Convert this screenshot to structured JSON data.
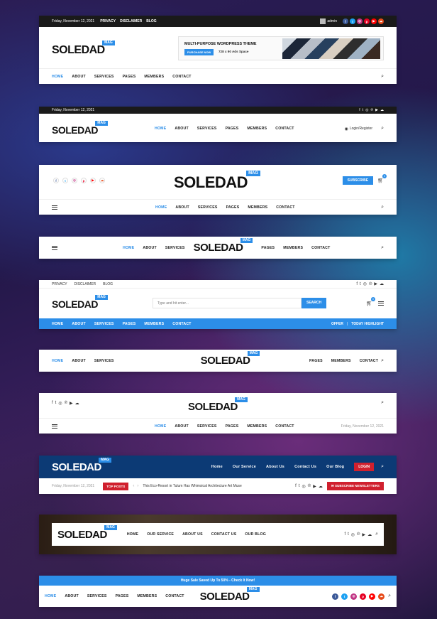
{
  "date": "Friday, November 12, 2021",
  "logo": {
    "text": "SOLEDAD",
    "badge": "MAG"
  },
  "h1": {
    "top_links": [
      "PRIVACY",
      "DISCLAIMER",
      "BLOG"
    ],
    "admin": "admin",
    "ad_title": "MULTI-PURPOSE WORDPRESS THEME",
    "ad_button": "PURCHASE NOW",
    "ad_size": "728 x 90 Ads Space",
    "nav": [
      "HOME",
      "ABOUT",
      "SERVICES",
      "PAGES",
      "MEMBERS",
      "CONTACT"
    ]
  },
  "h2": {
    "nav": [
      "HOME",
      "ABOUT",
      "SERVICES",
      "PAGES",
      "MEMBERS",
      "CONTACT"
    ],
    "login": "Login/Register"
  },
  "h3": {
    "subscribe": "SUBSCRIBE",
    "cart_count": "0",
    "nav": [
      "HOME",
      "ABOUT",
      "SERVICES",
      "PAGES",
      "MEMBERS",
      "CONTACT"
    ]
  },
  "h4": {
    "nav_left": [
      "HOME",
      "ABOUT",
      "SERVICES"
    ],
    "nav_right": [
      "PAGES",
      "MEMBERS",
      "CONTACT"
    ]
  },
  "h5": {
    "top_links": [
      "PRIVACY",
      "DISCLAIMER",
      "BLOG"
    ],
    "search_placeholder": "Type and hit enter...",
    "search_button": "SEARCH",
    "cart_count": "0",
    "nav": [
      "HOME",
      "ABOUT",
      "SERVICES",
      "PAGES",
      "MEMBERS",
      "CONTACT"
    ],
    "right_links": [
      "OFFER",
      "TODAY HIGHLIGHT"
    ]
  },
  "h6": {
    "nav_left": [
      "HOME",
      "ABOUT",
      "SERVICES"
    ],
    "nav_right": [
      "PAGES",
      "MEMBERS",
      "CONTACT"
    ]
  },
  "h7": {
    "nav": [
      "HOME",
      "ABOUT",
      "SERVICES",
      "PAGES",
      "MEMBERS",
      "CONTACT"
    ]
  },
  "h8": {
    "nav": [
      "Home",
      "Our Service",
      "About Us",
      "Contact Us",
      "Our Blog"
    ],
    "login": "LOGIN",
    "top_posts": "TOP POSTS",
    "ticker": "This Eco-Resort in Tulum Has Whimsical Architecture Art Muse",
    "newsletter": "SUBSCRIBE NEWSLETTERS"
  },
  "h9": {
    "nav": [
      "HOME",
      "OUR SERVICE",
      "ABOUT US",
      "CONTACT US",
      "OUR BLOG"
    ]
  },
  "h10": {
    "promo": "Huge Sale Saved Up To 50% - Check It Now!",
    "nav": [
      "HOME",
      "ABOUT",
      "SERVICES",
      "PAGES",
      "MEMBERS",
      "CONTACT"
    ]
  },
  "colors": {
    "accent": "#2c8ee8",
    "dark_navy": "#0c3a75",
    "red": "#d0202e"
  },
  "icons": [
    "search-icon",
    "facebook-icon",
    "twitter-icon",
    "instagram-icon",
    "pinterest-icon",
    "youtube-icon",
    "soundcloud-icon",
    "cart-icon",
    "menu-icon",
    "user-icon"
  ]
}
